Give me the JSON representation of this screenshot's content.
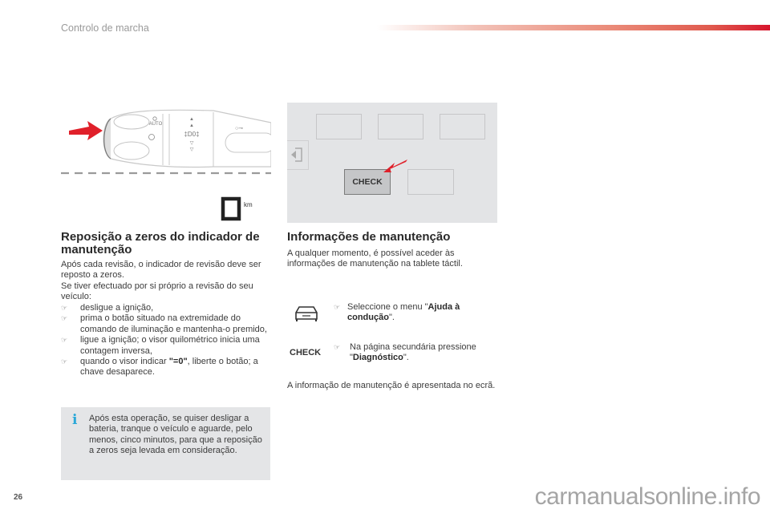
{
  "header": {
    "section_title": "Controlo de marcha",
    "accent_color": "#d7152d"
  },
  "illustrations": {
    "lever": {
      "icons": [
        "red-arrow",
        "stalk-reset-button",
        "auto-light-symbol",
        "light-symbols",
        "key-symbol"
      ],
      "labels": {
        "auto": "AUTO"
      },
      "display_unit": "km"
    },
    "tablet": {
      "check_button": "CHECK",
      "arrow_color": "#e0202a"
    }
  },
  "left_column": {
    "heading": "Reposição a zeros do indicador de manutenção",
    "intro_line1": "Após cada revisão, o indicador de revisão deve ser reposto a zeros.",
    "intro_line2": "Se tiver efectuado por si próprio a revisão do seu veículo:",
    "bullet_mark": "☞",
    "steps": [
      {
        "text": "desligue a ignição,"
      },
      {
        "text": "prima o botão situado na extremidade do comando de iluminação e mantenha-o premido,"
      },
      {
        "text": "ligue a ignição; o visor quilométrico inicia uma contagem inversa,"
      },
      {
        "text_before": "quando o visor indicar ",
        "text_bold": "\"=0\"",
        "text_after": ", liberte o botão; a chave desaparece."
      }
    ],
    "info_note": {
      "icon": "i",
      "text": "Após esta operação, se quiser desligar a bateria, tranque o veículo e aguarde, pelo menos, cinco minutos, para que a reposição a zeros seja levada em consideração."
    }
  },
  "right_column": {
    "heading": "Informações de manutenção",
    "intro": "A qualquer momento, é possível aceder às informações de manutenção na tablete táctil.",
    "step1": {
      "before": "Seleccione o menu \"",
      "bold": "Ajuda à condução",
      "after": "\"."
    },
    "step2": {
      "before": "Na página secundária pressione \"",
      "bold": "Diagnóstico",
      "after": "\"."
    },
    "check_label": "CHECK",
    "conclusion": "A informação de manutenção é apresentada no ecrã."
  },
  "footer": {
    "page_number": "26",
    "watermark": "carmanualsonline.info"
  }
}
